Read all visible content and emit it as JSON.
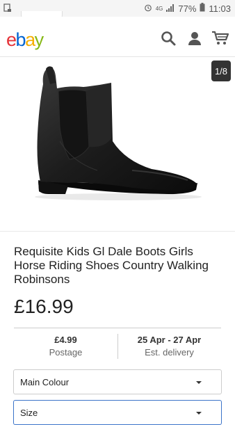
{
  "status_bar": {
    "network": "4G",
    "battery": "77%",
    "time": "11:03"
  },
  "header": {
    "logo_letters": [
      "e",
      "b",
      "a",
      "y"
    ],
    "logo_colors": [
      "#e53238",
      "#0064d2",
      "#f5af02",
      "#86b817"
    ],
    "icons": [
      "search-icon",
      "user-icon",
      "cart-icon"
    ]
  },
  "gallery": {
    "counter": "1/8"
  },
  "product": {
    "title": "Requisite Kids Gl Dale Boots Girls Horse Riding Shoes Country Walking Robinsons",
    "price": "£16.99"
  },
  "shipping": {
    "postage_value": "£4.99",
    "postage_label": "Postage",
    "delivery_value": "25 Apr - 27 Apr",
    "delivery_label": "Est. delivery"
  },
  "options": {
    "main_colour": "Main Colour",
    "size": "Size"
  }
}
